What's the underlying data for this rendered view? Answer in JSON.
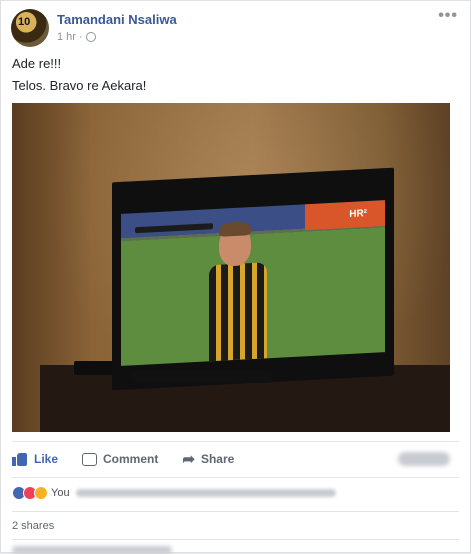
{
  "post": {
    "author": "Tamandani Nsaliwa",
    "time": "1 hr",
    "privacy_icon": "globe-icon",
    "more_label": "•••",
    "lines": [
      "Ade re!!!",
      "Telos. Bravo re Aekara!"
    ],
    "photo_alt": "photo of a TV showing a football player",
    "tv_channel": "HR²"
  },
  "actions": {
    "like": "Like",
    "comment": "Comment",
    "share": "Share"
  },
  "reactions": {
    "icons": [
      "like-icon",
      "love-icon",
      "haha-icon"
    ],
    "prefix": "You"
  },
  "shares": "2 shares",
  "colors": {
    "link": "#385898",
    "like_blue": "#4267b2",
    "meta_grey": "#90949c"
  }
}
